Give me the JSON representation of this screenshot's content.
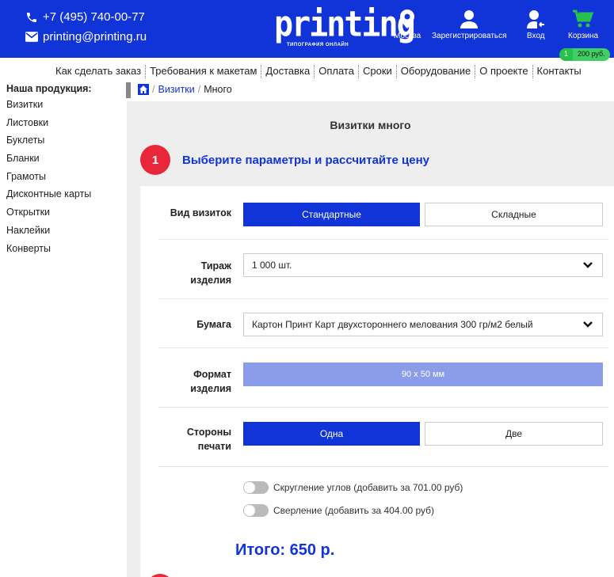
{
  "header": {
    "phone": "+7 (495) 740-00-77",
    "email": "printing@printing.ru",
    "logo_word": "printing",
    "logo_subtitle": "ТИПОГРАФИЯ ОНЛАЙН",
    "nav": [
      {
        "label": "Москва",
        "icon": "location-pin-icon"
      },
      {
        "label": "Зарегистрироваться",
        "icon": "user-icon"
      },
      {
        "label": "Вход",
        "icon": "login-icon"
      },
      {
        "label": "Корзина",
        "icon": "cart-icon"
      }
    ],
    "cart_count": "1",
    "cart_sum": "200 руб.",
    "colors": {
      "header_bg": "#1034d8",
      "cart_icon": "#27c24c"
    }
  },
  "top_menu": [
    "Как сделать заказ",
    "Требования к макетам",
    "Доставка",
    "Оплата",
    "Сроки",
    "Оборудование",
    "О проекте",
    "Контакты"
  ],
  "sidebar": {
    "title": "Наша продукция:",
    "items": [
      "Визитки",
      "Листовки",
      "Буклеты",
      "Бланки",
      "Грамоты",
      "Дисконтные карты",
      "Открытки",
      "Наклейки",
      "Конверты"
    ]
  },
  "breadcrumb": {
    "link": "Визитки",
    "sep": "/",
    "current": "Много"
  },
  "main": {
    "title": "Визитки много",
    "step_number": "1",
    "step_title": "Выберите параметры и рассчитайте цену",
    "type": {
      "label": "Вид визиток",
      "options": [
        "Стандартные",
        "Складные"
      ],
      "selected": "Стандартные"
    },
    "quantity": {
      "label_line1": "Тираж",
      "label_line2": "изделия",
      "value": "1 000 шт."
    },
    "paper": {
      "label": "Бумага",
      "value": "Картон Принт Карт двухстороннего мелования 300 гр/м2 белый"
    },
    "format": {
      "label_line1": "Формат",
      "label_line2": "изделия",
      "value": "90 x 50 мм"
    },
    "sides": {
      "label_line1": "Стороны",
      "label_line2": "печати",
      "options": [
        "Одна",
        "Две"
      ],
      "selected": "Одна"
    },
    "options": [
      {
        "label": "Скругление углов (добавить за 701.00 руб)",
        "enabled": false
      },
      {
        "label": "Сверление (добавить за 404.00 руб)",
        "enabled": false
      }
    ],
    "total": "Итого: 650 р.",
    "colors": {
      "accent": "#1034d8",
      "step_circle": "#e8283a",
      "format_bg": "#8b9de8",
      "panel_bg": "#eeeeee"
    }
  }
}
